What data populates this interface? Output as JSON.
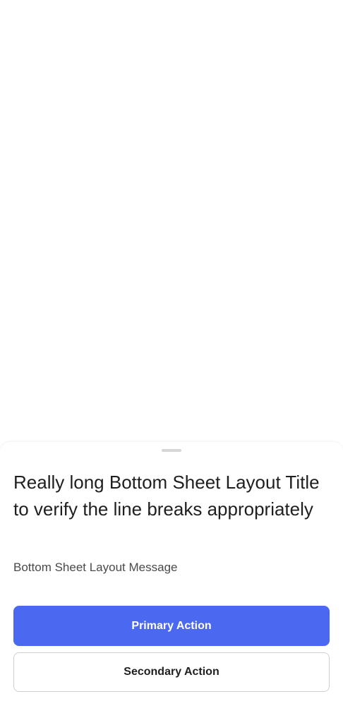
{
  "bottom_sheet": {
    "title": "Really long Bottom Sheet Layout Title to verify the line breaks appropriately",
    "message": "Bottom Sheet Layout Message",
    "primary_action_label": "Primary Action",
    "secondary_action_label": "Secondary Action"
  },
  "colors": {
    "primary_button": "#4b69f0",
    "background": "#ffffff",
    "title_text": "#1f1f1f",
    "message_text": "#4a4a4a",
    "secondary_border": "#cfcfcf",
    "handle": "#d6d6d6"
  }
}
